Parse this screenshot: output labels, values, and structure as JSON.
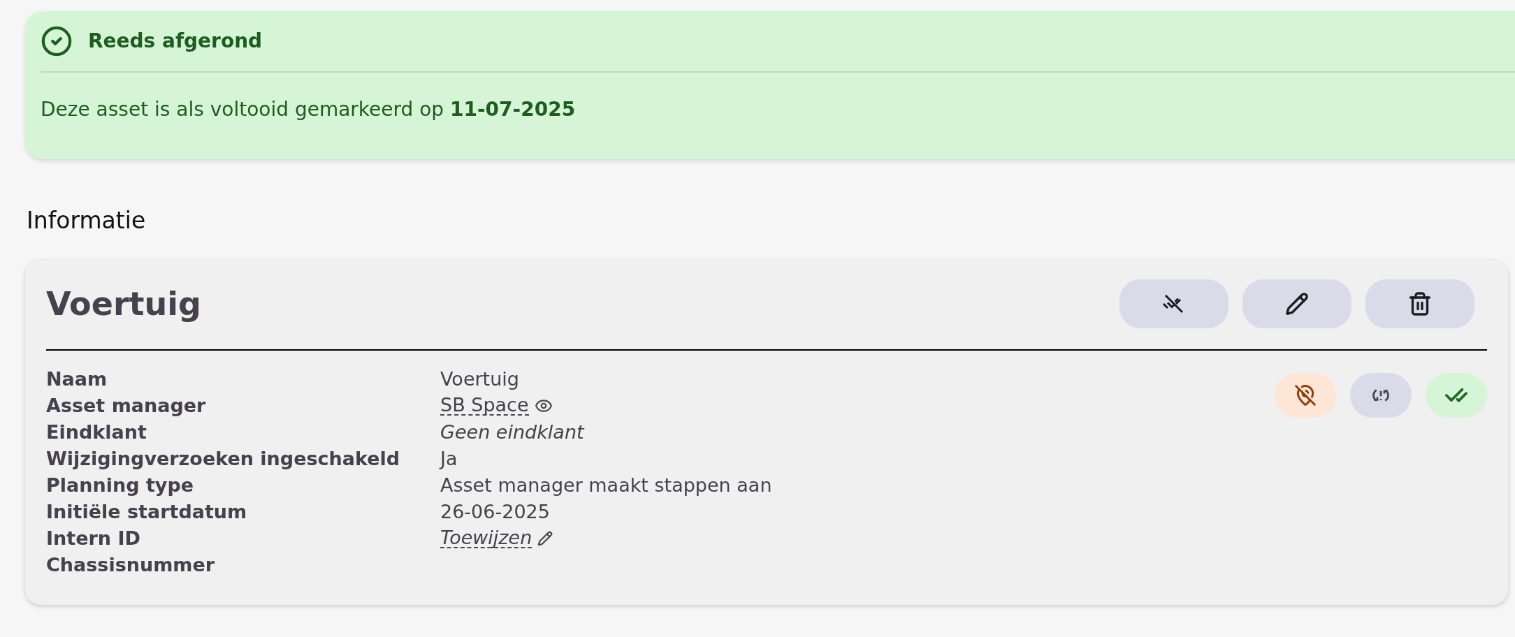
{
  "alert": {
    "title": "Reeds afgerond",
    "message": "Deze asset is als voltooid gemarkeerd op **11-07-2025**"
  },
  "section_title": "Informatie",
  "card": {
    "title": "Voertuig",
    "header_buttons": [
      {
        "kind": "remove-done"
      },
      {
        "kind": "edit"
      },
      {
        "kind": "delete"
      }
    ],
    "status_buttons": [
      {
        "kind": "location-off"
      },
      {
        "kind": "sync-problem"
      },
      {
        "kind": "done-all"
      }
    ],
    "fields": [
      {
        "label": "Naam",
        "kind": "text",
        "value": "Voertuig"
      },
      {
        "label": "Asset manager",
        "kind": "link",
        "value": "SB Space"
      },
      {
        "label": "Eindklant",
        "kind": "italic",
        "value": "Geen eindklant"
      },
      {
        "label": "Wijzigingverzoeken ingeschakeld",
        "kind": "text",
        "value": "Ja"
      },
      {
        "label": "Planning type",
        "kind": "text",
        "value": "Asset manager maakt stappen aan"
      },
      {
        "label": "Initiële startdatum",
        "kind": "text",
        "value": "26-06-2025"
      },
      {
        "label": "Intern ID",
        "kind": "edit-link",
        "value": "Toewijzen"
      },
      {
        "label": "Chassisnummer",
        "kind": "empty"
      }
    ]
  }
}
